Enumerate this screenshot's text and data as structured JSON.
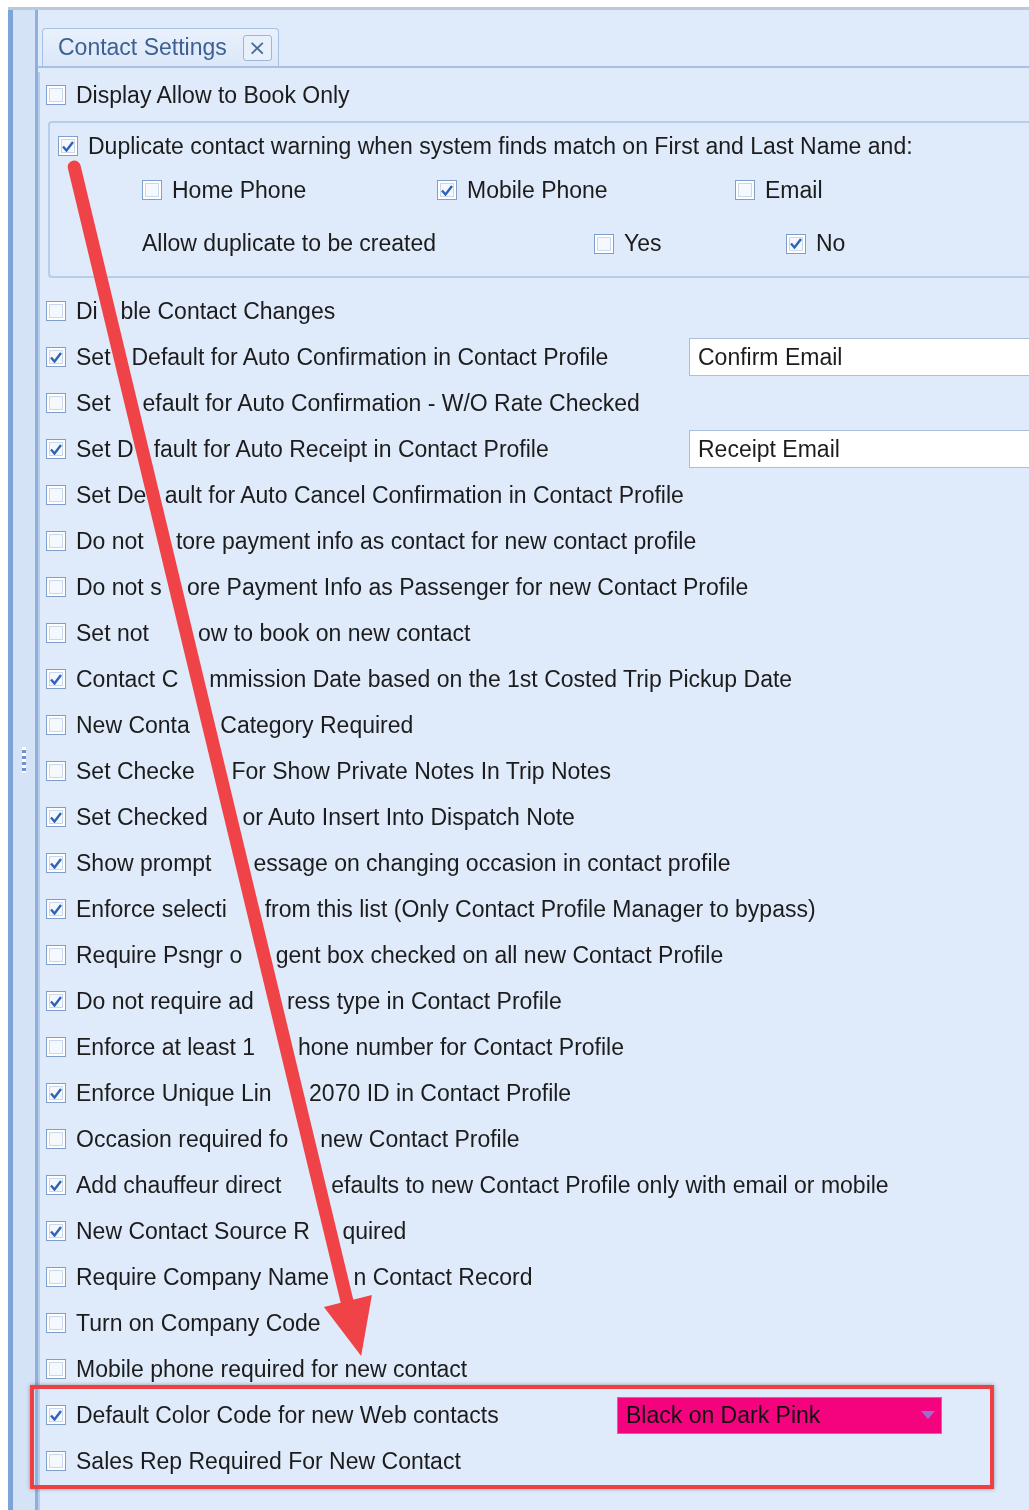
{
  "tab": {
    "title": "Contact Settings",
    "close": "×"
  },
  "settings": [
    {
      "kind": "checkbox",
      "label": "Display Allow to Book Only",
      "checked": false
    },
    {
      "kind": "group",
      "label": "Duplicate contact warning when system finds match on First and Last Name and:",
      "checked": true,
      "options": [
        {
          "label": "Home Phone",
          "checked": false
        },
        {
          "label": "Mobile Phone",
          "checked": true
        },
        {
          "label": "Email",
          "checked": false
        }
      ],
      "duplicate": {
        "label": "Allow duplicate to be created",
        "choices": [
          {
            "label": "Yes",
            "checked": false
          },
          {
            "label": "No",
            "checked": true
          }
        ]
      }
    },
    {
      "kind": "checkbox",
      "label_parts": [
        "Di",
        "ble Contact Changes"
      ],
      "checked": false
    },
    {
      "kind": "field",
      "label_parts": [
        "Set",
        "Default for Auto Confirmation in Contact Profile"
      ],
      "checked": true,
      "value": "Confirm Email"
    },
    {
      "kind": "checkbox",
      "label_parts": [
        "Set",
        "efault for Auto Confirmation - W/O Rate Checked"
      ],
      "checked": false
    },
    {
      "kind": "field",
      "label_parts": [
        "Set D",
        "fault for Auto Receipt in Contact Profile"
      ],
      "checked": true,
      "value": "Receipt Email"
    },
    {
      "kind": "checkbox",
      "label_parts": [
        "Set De",
        "ault for Auto Cancel Confirmation in Contact Profile"
      ],
      "checked": false
    },
    {
      "kind": "checkbox",
      "label_parts": [
        "Do not",
        "tore payment info as contact for new contact profile"
      ],
      "checked": false
    },
    {
      "kind": "checkbox",
      "label_parts": [
        "Do not s",
        "ore Payment Info as Passenger for new Contact Profile"
      ],
      "checked": false
    },
    {
      "kind": "checkbox",
      "label_parts": [
        "Set not",
        "ow to book on new contact"
      ],
      "checked": false
    },
    {
      "kind": "checkbox",
      "label_parts": [
        "Contact C",
        "mmission Date based on the 1st Costed Trip Pickup Date"
      ],
      "checked": true
    },
    {
      "kind": "checkbox",
      "label_parts": [
        "New Conta",
        "Category Required"
      ],
      "checked": false
    },
    {
      "kind": "checkbox",
      "label_parts": [
        "Set Checke",
        "For Show Private Notes In Trip Notes"
      ],
      "checked": false
    },
    {
      "kind": "checkbox",
      "label_parts": [
        "Set Checked",
        "or Auto Insert Into Dispatch Note"
      ],
      "checked": true
    },
    {
      "kind": "checkbox",
      "label_parts": [
        "Show prompt",
        "essage on changing occasion in contact profile"
      ],
      "checked": true
    },
    {
      "kind": "checkbox",
      "label_parts": [
        "Enforce selecti",
        "from this list (Only Contact Profile Manager to bypass)"
      ],
      "checked": true
    },
    {
      "kind": "checkbox",
      "label_parts": [
        "Require Psngr o",
        "gent box checked on all new Contact Profile"
      ],
      "checked": false
    },
    {
      "kind": "checkbox",
      "label_parts": [
        "Do not require ad",
        "ress type in Contact Profile"
      ],
      "checked": true
    },
    {
      "kind": "checkbox",
      "label_parts": [
        "Enforce at least 1",
        "hone number for Contact Profile"
      ],
      "checked": false
    },
    {
      "kind": "checkbox",
      "label_parts": [
        "Enforce Unique Lin",
        "2070 ID in Contact Profile"
      ],
      "checked": true
    },
    {
      "kind": "checkbox",
      "label_parts": [
        "Occasion required fo",
        "new Contact Profile"
      ],
      "checked": false
    },
    {
      "kind": "checkbox",
      "label_parts": [
        "Add chauffeur direct",
        "efaults to new Contact Profile only with email or mobile"
      ],
      "checked": true
    },
    {
      "kind": "checkbox",
      "label_parts": [
        "New Contact Source R",
        "quired"
      ],
      "checked": true
    },
    {
      "kind": "checkbox",
      "label_parts": [
        "Require Company Name",
        "n Contact Record"
      ],
      "checked": false
    },
    {
      "kind": "checkbox",
      "label": "Turn on Company Code",
      "checked": false
    },
    {
      "kind": "checkbox",
      "label": "Mobile phone required for new contact",
      "checked": false
    },
    {
      "kind": "select",
      "label": "Default Color Code for new Web contacts",
      "checked": true,
      "value": "Black on Dark Pink",
      "color": "#f5037f"
    },
    {
      "kind": "checkbox",
      "label": "Sales Rep Required For New Contact",
      "checked": false
    }
  ]
}
